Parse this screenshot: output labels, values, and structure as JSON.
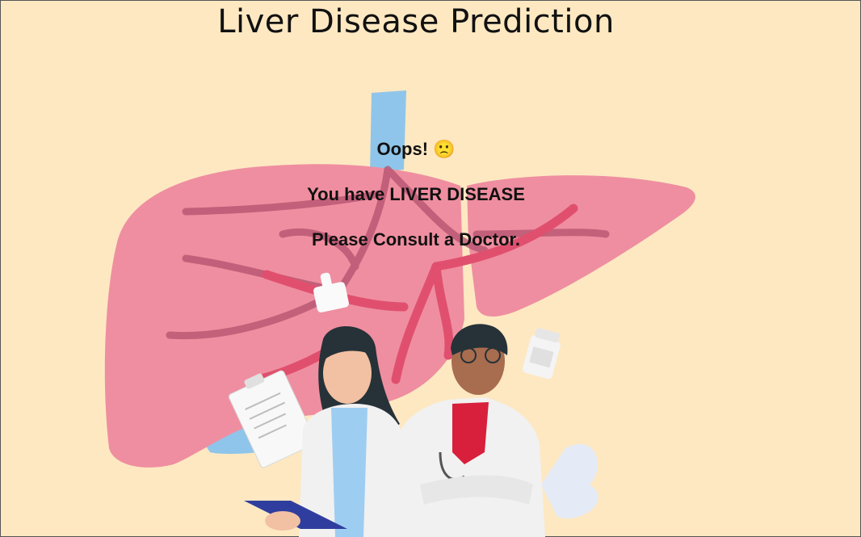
{
  "page": {
    "title": "Liver Disease Prediction"
  },
  "result": {
    "headline": "Oops! 🙁",
    "diagnosis": "You have LIVER DISEASE",
    "advice": "Please Consult a Doctor."
  },
  "illustration": {
    "subject": "liver-with-two-doctors",
    "colors": {
      "background": "#fde8c2",
      "liver": "#ef8ea0",
      "vessel": "#e0506e",
      "portal_vein": "#8fc5ea",
      "coat": "#f1f1f1"
    }
  }
}
